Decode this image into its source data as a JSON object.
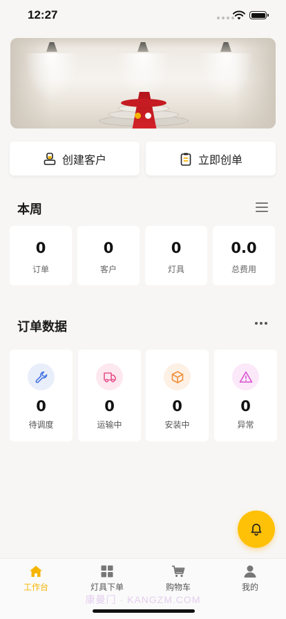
{
  "status_bar": {
    "time": "12:27"
  },
  "banner": {
    "dots": [
      {
        "color": "#f5b400",
        "active": true
      },
      {
        "color": "#ffffff",
        "active": false
      }
    ]
  },
  "actions": {
    "create_customer": "创建客户",
    "create_order": "立即创单"
  },
  "this_week": {
    "title": "本周",
    "stats": [
      {
        "value": "0",
        "label": "订单"
      },
      {
        "value": "0",
        "label": "客户"
      },
      {
        "value": "0",
        "label": "灯具"
      },
      {
        "value": "0.0",
        "label": "总费用"
      }
    ]
  },
  "order_data": {
    "title": "订单数据",
    "cards": [
      {
        "value": "0",
        "label": "待调度",
        "icon": "wrench-icon",
        "color": "#4a78e0",
        "bg": "#e9eefb"
      },
      {
        "value": "0",
        "label": "运输中",
        "icon": "truck-icon",
        "color": "#e8508a",
        "bg": "#fde8f0"
      },
      {
        "value": "0",
        "label": "安装中",
        "icon": "box-icon",
        "color": "#f0903a",
        "bg": "#fdf0e4"
      },
      {
        "value": "0",
        "label": "异常",
        "icon": "warning-icon",
        "color": "#d84fd0",
        "bg": "#fbe8f9"
      }
    ]
  },
  "fab": {
    "icon": "bell-icon",
    "color": "#ffc107"
  },
  "tab_bar": {
    "accent": "#f5b400",
    "tabs": [
      {
        "label": "工作台",
        "icon": "home-icon",
        "active": true
      },
      {
        "label": "灯具下单",
        "icon": "grid-icon",
        "active": false
      },
      {
        "label": "购物车",
        "icon": "cart-icon",
        "active": false
      },
      {
        "label": "我的",
        "icon": "user-icon",
        "active": false
      }
    ]
  },
  "watermark": "康曼门 · KANGZM.COM"
}
